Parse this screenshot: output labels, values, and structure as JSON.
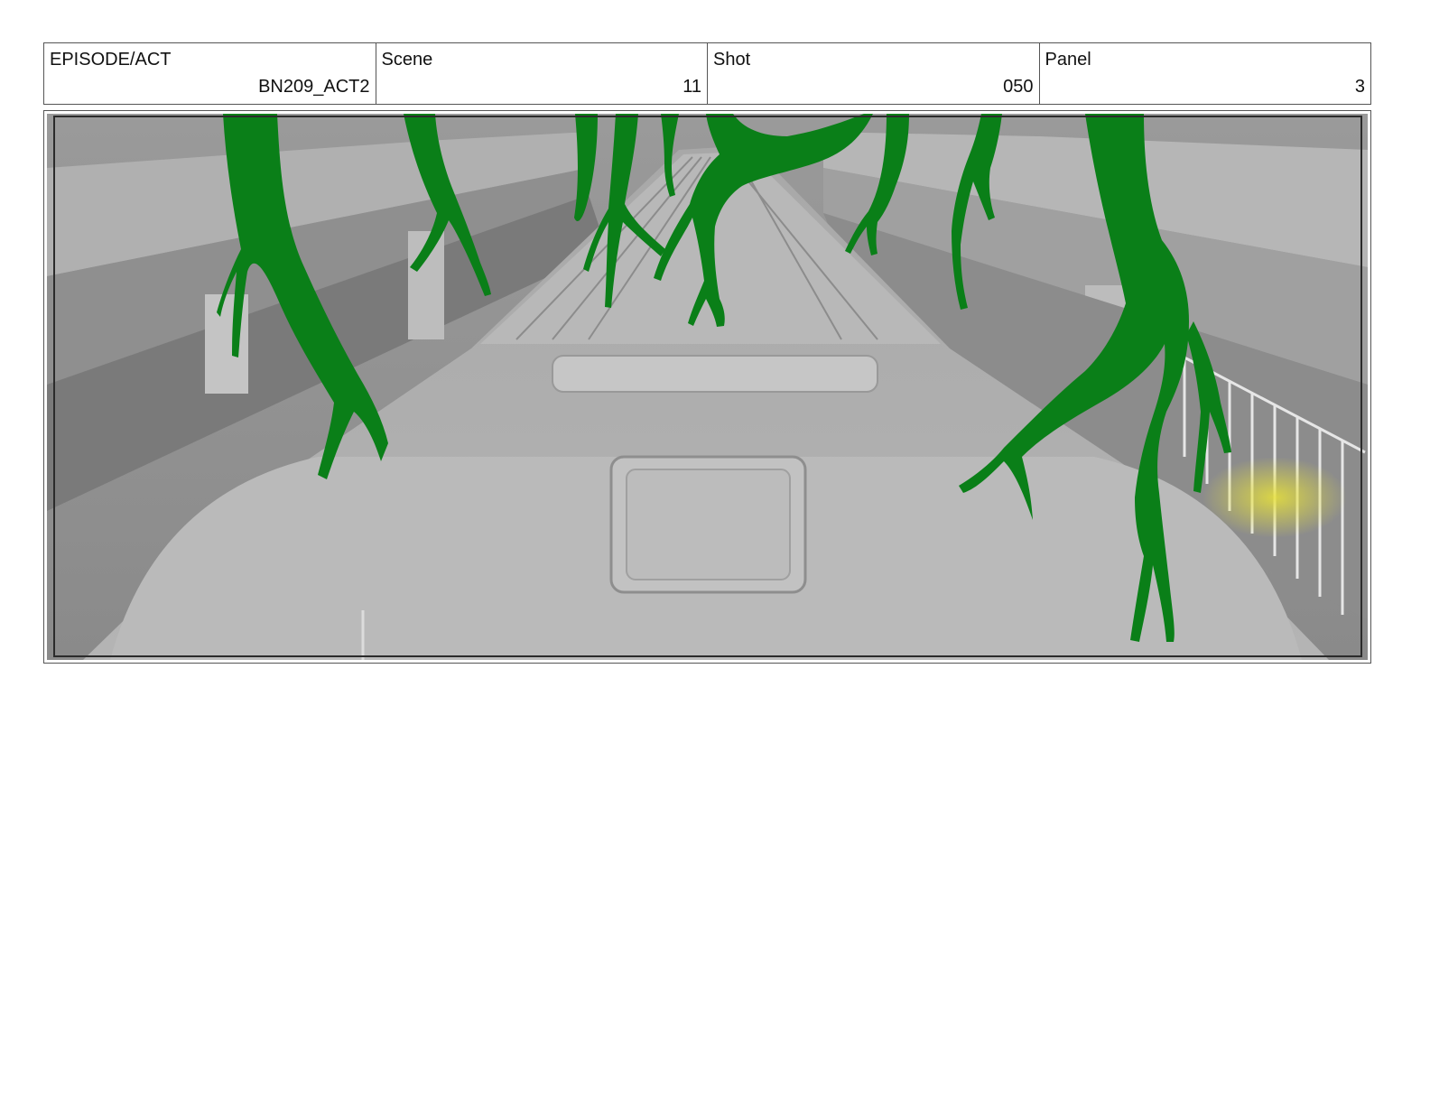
{
  "header": {
    "episode": {
      "label": "EPISODE/ACT",
      "value": "BN209_ACT2"
    },
    "scene": {
      "label": "Scene",
      "value": "11"
    },
    "shot": {
      "label": "Shot",
      "value": "050"
    },
    "panel": {
      "label": "Panel",
      "value": "3"
    }
  },
  "colors": {
    "vines": "#0a7f18",
    "glow": "#e8e23a",
    "frame": "#2b2b2b"
  }
}
